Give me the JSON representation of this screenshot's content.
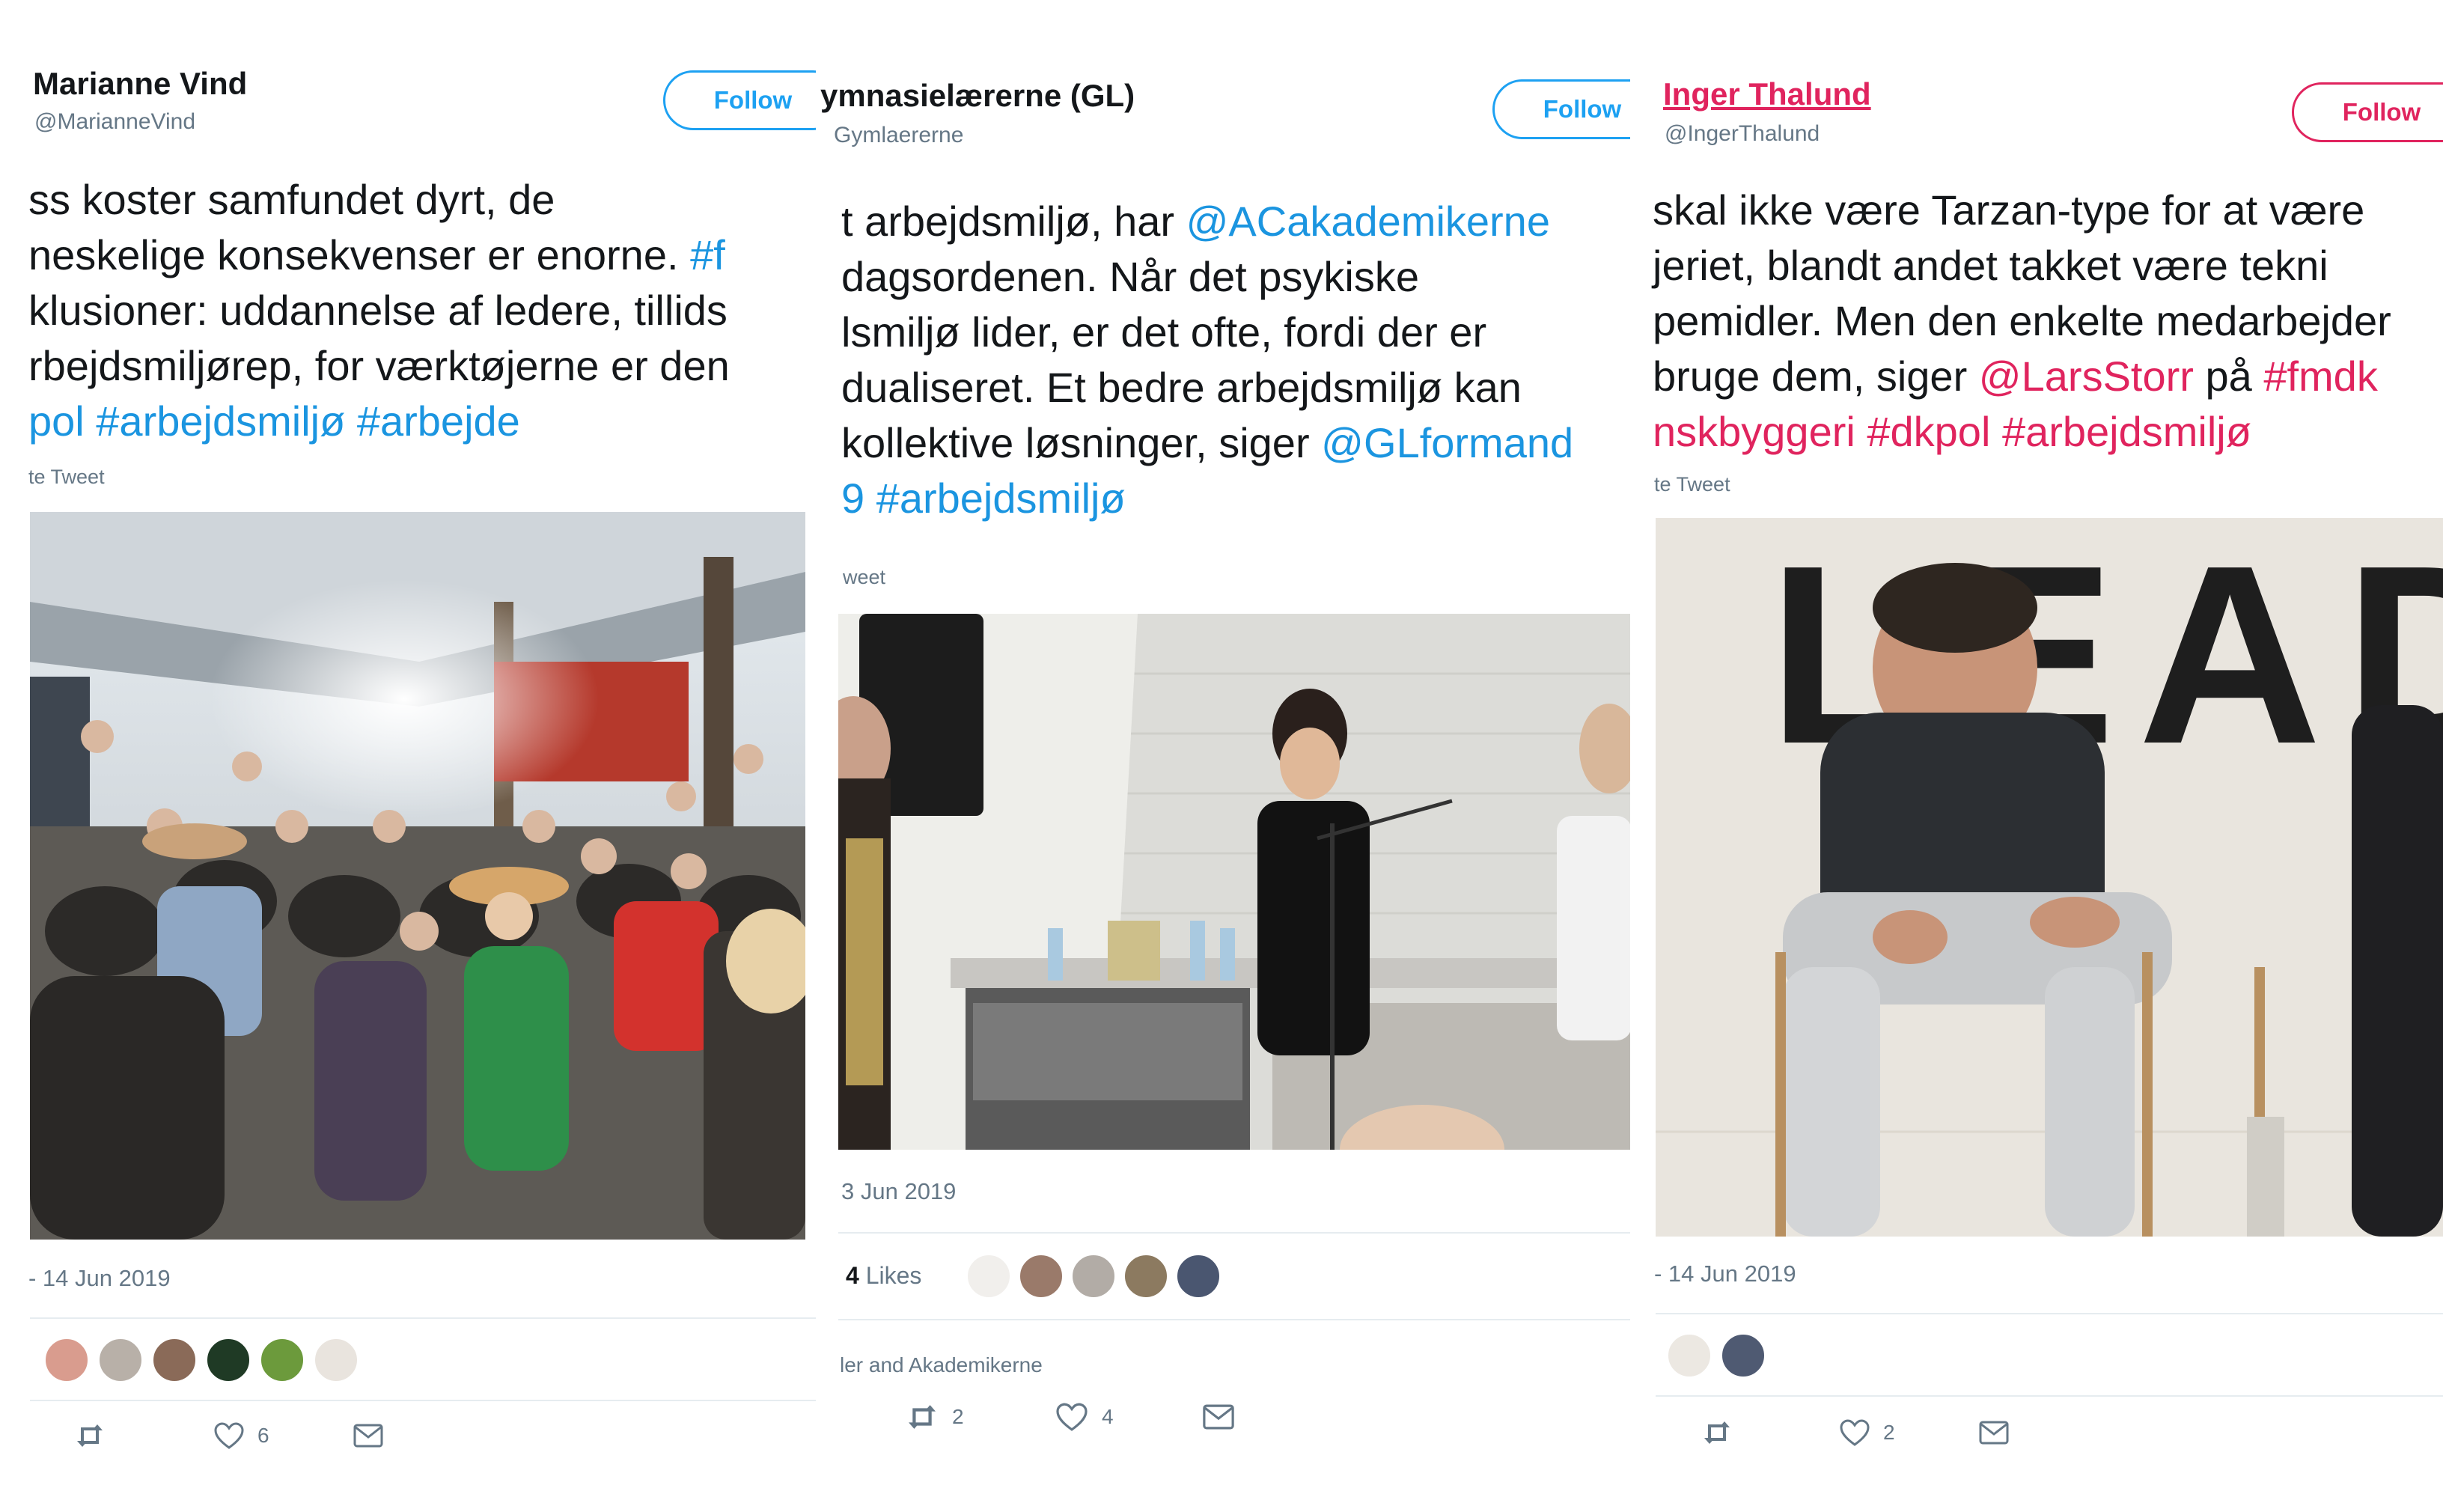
{
  "tweets": [
    {
      "name": "Marianne Vind",
      "handle": "@MarianneVind",
      "follow": "Follow",
      "lines": [
        [
          {
            "t": "ss koster samfundet dyrt, de"
          }
        ],
        [
          {
            "t": "neskelige konsekvenser er enorne. "
          },
          {
            "t": "#f",
            "tag": true
          }
        ],
        [
          {
            "t": "klusioner: uddannelse af ledere, tillids"
          }
        ],
        [
          {
            "t": "rbejdsmiljørep, for værktøjerne er den"
          }
        ],
        [
          {
            "t": "pol #arbejdsmiljø #arbejde",
            "tag": true
          }
        ]
      ],
      "translate": "te Tweet",
      "date": "- 14 Jun 2019",
      "actions": {
        "retweet": "",
        "like": "6",
        "mail": ""
      }
    },
    {
      "name": "ymnasielærerne (GL)",
      "handle": "Gymlaererne",
      "follow": "Follow",
      "lines": [
        [
          {
            "t": "t arbejdsmiljø, har "
          },
          {
            "t": "@ACakademikerne",
            "tag": true
          }
        ],
        [
          {
            "t": " dagsordenen. Når det psykiske"
          }
        ],
        [
          {
            "t": "lsmiljø lider, er det ofte, fordi der er"
          }
        ],
        [
          {
            "t": "dualiseret. Et bedre arbejdsmiljø kan"
          }
        ],
        [
          {
            "t": "kollektive løsninger, siger "
          },
          {
            "t": "@GLformand",
            "tag": true
          }
        ],
        [
          {
            "t": "9 #arbejdsmiljø",
            "tag": true
          }
        ]
      ],
      "translate": "weet",
      "date": "3 Jun 2019",
      "likes_count": "4",
      "likes_label": "Likes",
      "replying": "ler and Akademikerne",
      "actions": {
        "retweet": "2",
        "like": "4",
        "mail": ""
      }
    },
    {
      "name": "Inger Thalund",
      "handle": "@IngerThalund",
      "follow": "Follow",
      "lines": [
        [
          {
            "t": " skal ikke være Tarzan-type for at være"
          }
        ],
        [
          {
            "t": "jeriet, blandt andet takket være  tekni"
          }
        ],
        [
          {
            "t": "pemidler. Men den enkelte medarbejder"
          }
        ],
        [
          {
            "t": "bruge dem, siger "
          },
          {
            "t": "@LarsStorr",
            "tag": true
          },
          {
            "t": " på "
          },
          {
            "t": "#fmdk",
            "tag": true
          }
        ],
        [
          {
            "t": "nskbyggeri #dkpol #arbejdsmiljø",
            "tag": true
          }
        ]
      ],
      "translate": "te Tweet",
      "date": "- 14 Jun 2019",
      "photo_sign": "LEAD",
      "actions": {
        "retweet": "",
        "like": "2",
        "mail": ""
      }
    }
  ],
  "colors": {
    "link": "#1b95e0",
    "link_red": "#e0245e",
    "muted": "#657786",
    "follow": "#1da1f2"
  }
}
